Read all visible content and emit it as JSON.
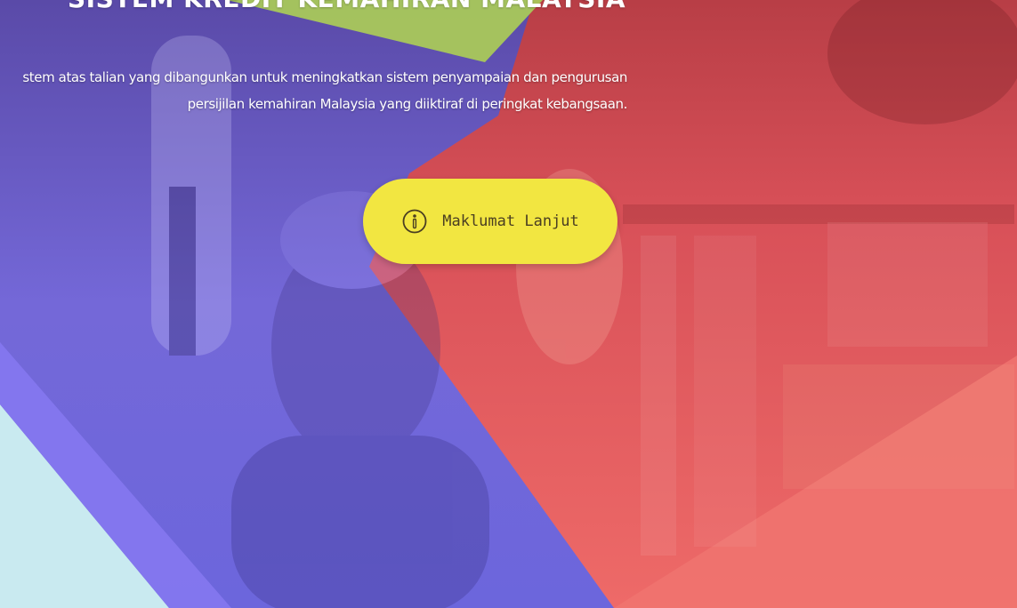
{
  "hero": {
    "title": "SISTEM KREDIT KEMAHIRAN MALAYSIA",
    "description_line1": "stem atas talian yang dibangunkan untuk meningkatkan sistem penyampaian dan pengurusan",
    "description_line2": "persijilan kemahiran Malaysia yang diiktiraf di peringkat kebangsaan.",
    "cta_label": "Maklumat Lanjut",
    "cta_icon": "info-circle-icon"
  },
  "colors": {
    "purple_overlay": "#7a6ee0",
    "red_overlay": "#ec6464",
    "green_accent": "#a9c85a",
    "light_blue": "#c9eaf0",
    "button_yellow": "#f2e641",
    "text_white": "#ffffff"
  }
}
